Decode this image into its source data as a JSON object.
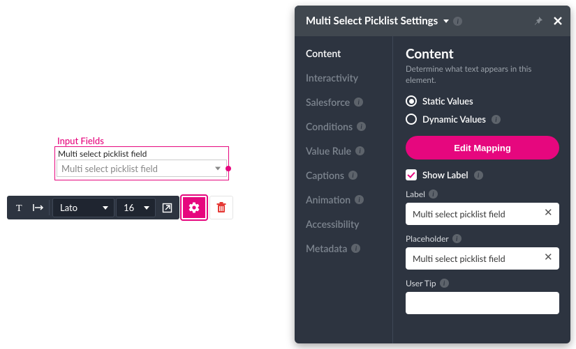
{
  "canvas": {
    "group_label": "Input Fields",
    "field_label": "Multi select picklist field",
    "field_placeholder": "Multi select picklist field"
  },
  "toolbar": {
    "font_name": "Lato",
    "font_size": "16"
  },
  "panel": {
    "title": "Multi Select Picklist Settings",
    "nav": {
      "content": "Content",
      "interactivity": "Interactivity",
      "salesforce": "Salesforce",
      "conditions": "Conditions",
      "value_rule": "Value Rule",
      "captions": "Captions",
      "animation": "Animation",
      "accessibility": "Accessibility",
      "metadata": "Metadata"
    },
    "content": {
      "heading": "Content",
      "description": "Determine what text appears in this element.",
      "radio_static": "Static Values",
      "radio_dynamic": "Dynamic Values",
      "edit_mapping": "Edit Mapping",
      "show_label": "Show Label",
      "label_caption": "Label",
      "label_value": "Multi select picklist field",
      "placeholder_caption": "Placeholder",
      "placeholder_value": "Multi select picklist field",
      "user_tip_caption": "User Tip",
      "user_tip_value": ""
    }
  }
}
